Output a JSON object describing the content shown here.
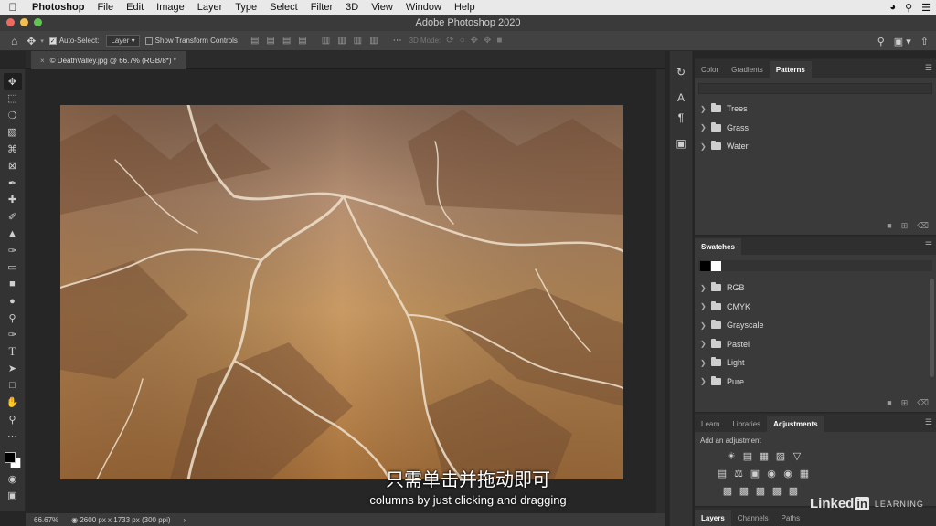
{
  "menubar": {
    "app": "Photoshop",
    "items": [
      "File",
      "Edit",
      "Image",
      "Layer",
      "Type",
      "Select",
      "Filter",
      "3D",
      "View",
      "Window",
      "Help"
    ]
  },
  "window": {
    "title": "Adobe Photoshop 2020"
  },
  "options_bar": {
    "auto_select_label": "Auto-Select:",
    "auto_select_value": "Layer",
    "show_transform_label": "Show Transform Controls",
    "mode_3d_label": "3D Mode:"
  },
  "document": {
    "tab_label": "© DeathValley.jpg @ 66.7% (RGB/8*) *",
    "zoom": "66.67%",
    "info": "2600 px x 1733 px (300 ppi)"
  },
  "patterns_panel": {
    "tabs": [
      "Color",
      "Gradients",
      "Patterns"
    ],
    "active_tab": "Patterns",
    "groups": [
      "Trees",
      "Grass",
      "Water"
    ]
  },
  "swatches_panel": {
    "tab": "Swatches",
    "recent": [
      "#000000",
      "#ffffff"
    ],
    "groups": [
      "RGB",
      "CMYK",
      "Grayscale",
      "Pastel",
      "Light",
      "Pure"
    ]
  },
  "adjustments_panel": {
    "tabs": [
      "Learn",
      "Libraries",
      "Adjustments"
    ],
    "active_tab": "Adjustments",
    "hint": "Add an adjustment"
  },
  "layers_panel": {
    "tabs": [
      "Layers",
      "Channels",
      "Paths"
    ],
    "active_tab": "Layers"
  },
  "subtitles": {
    "cn": "只需单击并拖动即可",
    "en": "columns by just clicking and dragging"
  },
  "brand": {
    "name": "Linked",
    "in": "in",
    "suffix": "LEARNING"
  },
  "colors": {
    "accent_red": "#ed6a5e",
    "accent_yellow": "#f4bf4f",
    "accent_green": "#61c554"
  }
}
